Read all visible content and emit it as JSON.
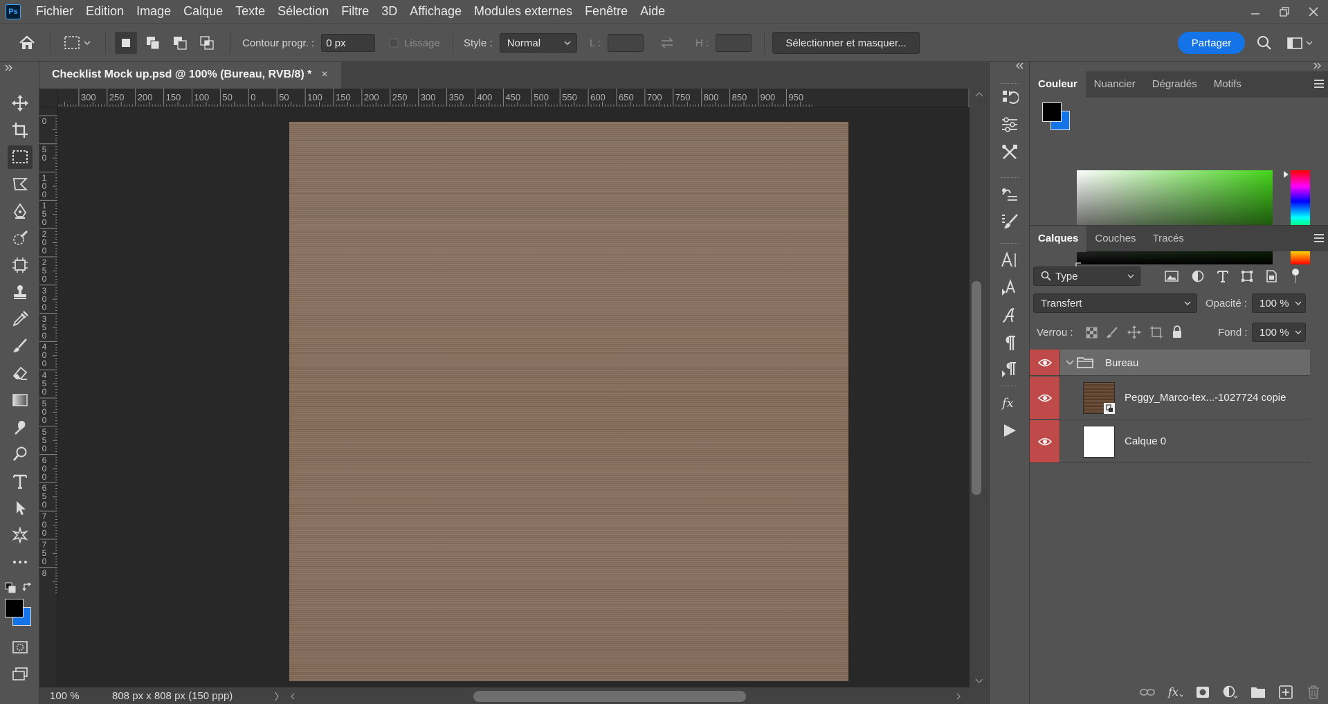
{
  "app": {
    "logo_text": "Ps"
  },
  "menu": [
    "Fichier",
    "Edition",
    "Image",
    "Calque",
    "Texte",
    "Sélection",
    "Filtre",
    "3D",
    "Affichage",
    "Modules externes",
    "Fenêtre",
    "Aide"
  ],
  "options": {
    "feather_label": "Contour progr. :",
    "feather_value": "0 px",
    "antialias_label": "Lissage",
    "style_label": "Style :",
    "style_value": "Normal",
    "width_label": "L :",
    "height_label": "H :",
    "select_mask_label": "Sélectionner et masquer...",
    "share_label": "Partager"
  },
  "document": {
    "tab_title": "Checklist Mock up.psd @ 100% (Bureau, RVB/8) *",
    "close_glyph": "×",
    "zoom": "100 %",
    "size_info": "808 px x 808 px (150 ppp)",
    "status_arrow": "〉",
    "texture_colors": {
      "base": "#8b7462"
    }
  },
  "rulers": {
    "horizontal": [
      "0",
      "300",
      "250",
      "200",
      "150",
      "100",
      "50",
      "0",
      "50",
      "100",
      "150",
      "200",
      "250",
      "300",
      "350",
      "400",
      "450",
      "500",
      "550",
      "600",
      "650",
      "700",
      "750",
      "800",
      "850",
      "900",
      "950"
    ],
    "vertical": [
      "0",
      "50",
      "100",
      "150",
      "200",
      "250",
      "300",
      "350",
      "400",
      "450",
      "500",
      "550",
      "600",
      "650",
      "700",
      "750",
      "8"
    ]
  },
  "color_panel": {
    "tabs": [
      "Couleur",
      "Nuancier",
      "Dégradés",
      "Motifs"
    ],
    "foreground": "#000000",
    "background": "#1473e6"
  },
  "layers_panel": {
    "tabs": [
      "Calques",
      "Couches",
      "Tracés"
    ],
    "filter_value": "Type",
    "blend_mode": "Transfert",
    "opacity_label": "Opacité :",
    "opacity_value": "100 %",
    "lock_label": "Verrou :",
    "fill_label": "Fond :",
    "fill_value": "100 %",
    "layers": [
      {
        "name": "Bureau",
        "type": "group"
      },
      {
        "name": "Peggy_Marco-tex...-1027724 copie",
        "type": "smart-object"
      },
      {
        "name": "Calque 0",
        "type": "pixel"
      }
    ]
  },
  "colors": {
    "accent": "#1473e6",
    "visibility_highlight": "#c04a4a"
  }
}
